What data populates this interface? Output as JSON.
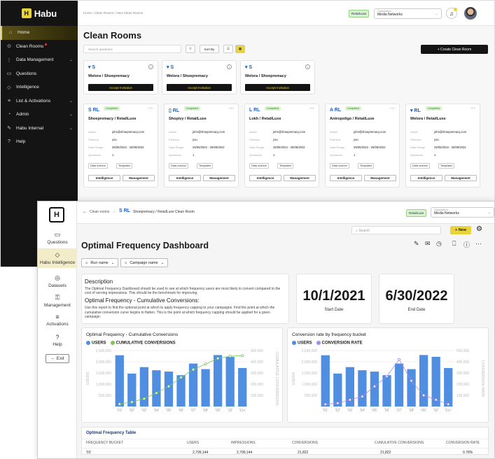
{
  "back": {
    "logo": "Habu",
    "nav": [
      {
        "label": "Home",
        "icon": "⌂",
        "active": true,
        "chev": false
      },
      {
        "label": "Clean Rooms",
        "icon": "⊙",
        "chev": false,
        "dot": true
      },
      {
        "label": "Data Management",
        "icon": "⋮",
        "chev": true
      },
      {
        "label": "Questions",
        "icon": "▭",
        "chev": false
      },
      {
        "label": "Intelligence",
        "icon": "◇",
        "chev": false
      },
      {
        "label": "List & Activations",
        "icon": "≡",
        "chev": true
      },
      {
        "label": "Admin",
        "icon": "◔",
        "chev": true
      },
      {
        "label": "Habu Internal",
        "icon": "✎",
        "chev": true
      },
      {
        "label": "Help",
        "icon": "?",
        "chev": false
      }
    ],
    "breadcrumb": "Home  /  Clean Rooms  /  View Clean Rooms",
    "chip": "RetailLuxe",
    "org_label": "Organization",
    "org_value": "Media Networks",
    "title": "Clean Rooms",
    "search_placeholder": "Search questions",
    "sort": "Sort By",
    "create": "+  Create Clean Room",
    "invites": [
      {
        "logo": "▾ S",
        "name": "Welora / Shoepremacy",
        "btn": "Accept Invitation"
      },
      {
        "logo": "▾ S",
        "name": "Welora / Shoepremacy",
        "btn": "Accept Invitation"
      },
      {
        "logo": "▾ S",
        "name": "Welora / Shoepremacy",
        "btn": "Accept Invitation"
      }
    ],
    "rooms": [
      {
        "logo": "S RL",
        "name": "Shoepremacy / RetailLuxe"
      },
      {
        "logo": "▯ RL",
        "name": "Shopivy / RetailLuxe"
      },
      {
        "logo": "L RL",
        "name": "Lokh / RetailLuxe"
      },
      {
        "logo": "A RL",
        "name": "Antropoligo / RetailLuxe"
      },
      {
        "logo": "▾ RL",
        "name": "Welora / RetailLuxe"
      }
    ],
    "room_tag": "Completed",
    "kv_keys": [
      "Admin",
      "Partners",
      "Data Range",
      "Questions"
    ],
    "kv_vals": [
      "john@shoepremacy.com",
      "you",
      "25/05/2022 - 25/06/2022",
      "1"
    ],
    "pills": [
      "Data science",
      "Templates"
    ],
    "btn_intel": "Intelligence",
    "btn_mgmt": "Management"
  },
  "front": {
    "logo": "H",
    "nav": [
      {
        "label": "Questions",
        "icon": "▭"
      },
      {
        "label": "Habu Intelligence",
        "icon": "◇",
        "active": true
      },
      {
        "label": "Datasets",
        "icon": "◎"
      },
      {
        "label": "Management",
        "icon": "⚿"
      },
      {
        "label": "Activations",
        "icon": "≡"
      },
      {
        "label": "Help",
        "icon": "?"
      },
      {
        "label": "← Exit",
        "icon": ""
      }
    ],
    "crumb_back": "Clean rooms",
    "crumb_logo": "S RL",
    "crumb": "Shoepremacy / RetailLuxe Clean Room",
    "chip": "RetailLuxe",
    "org_label": "Organization",
    "org_value": "Media Networks",
    "search_placeholder": "Search",
    "new_btn": "+  New",
    "title": "Optimal Frequency Dashboard",
    "filters": [
      "Run name",
      "Campaign name"
    ],
    "desc": {
      "h1": "Description",
      "p1": "The Optimal Frequency Dashboard should be used to see at which frequency users are most likely to convert compared to the cost of serving impressions. This should be the benchmark for improving.",
      "h2": "Optimal Frequency - Cumulative Conversions:",
      "p2": "Use this report to find the optional point at which to apply frequency capping to your campaigns. Find the point at which the cumulative conversion curve begins to flatten. This is the point at which frequency capping should be applied for a given campaign."
    },
    "start_date": "10/1/2021",
    "start_label": "Start Date",
    "end_date": "6/30/2022",
    "end_label": "End Date",
    "table": {
      "title": "Optimal Frequency Table",
      "headers": [
        "FREQUENCY BUCKET",
        "USERS",
        "IMPRESSIONS",
        "CONVERSIONS",
        "CUMULATIVE CONVERSIONS",
        "CONVERSION RATE"
      ],
      "row": [
        "'01'",
        "2,799,144",
        "2,799,144",
        "21,822",
        "21,822",
        "0.78%"
      ]
    }
  },
  "chart_data": [
    {
      "type": "bar",
      "title": "Optimal Frequency - Cumulative Conversions",
      "categories": [
        "'01'",
        "'02'",
        "'03'",
        "'04'",
        "'05'",
        "'06'",
        "'07'",
        "'08'",
        "'09'",
        "'10'",
        "'11+'"
      ],
      "ylabel": "USERS",
      "y2label": "CUMULATIVE CONVERSIONS",
      "ylim": [
        0,
        2500000
      ],
      "y2lim": [
        0,
        500000
      ],
      "yticks": [
        "2,500,000",
        "2,000,000",
        "1,500,000",
        "1,000,000",
        "500,000",
        ""
      ],
      "y2ticks": [
        "500,000",
        "400,000",
        "300,000",
        "200,000",
        "100,000",
        ""
      ],
      "series": [
        {
          "name": "USERS",
          "type": "bar",
          "color": "#4f8ee0",
          "values": [
            2290000,
            1470000,
            1760000,
            1620000,
            1560000,
            1400000,
            1920000,
            1670000,
            2300000,
            2220000,
            1720000
          ]
        },
        {
          "name": "CUMULATIVE CONVERSIONS",
          "type": "line",
          "color": "#7cc55b",
          "values": [
            21822,
            40000,
            70000,
            120000,
            180000,
            260000,
            330000,
            380000,
            430000,
            450000,
            455000
          ]
        }
      ]
    },
    {
      "type": "bar",
      "title": "Conversion rate by frequency bucket",
      "categories": [
        "'01'",
        "'02'",
        "'03'",
        "'04'",
        "'05'",
        "'06'",
        "'07'",
        "'08'",
        "'09'",
        "'10'",
        "'11+'"
      ],
      "ylabel": "USERS",
      "y2label": "CONVERSION RATE",
      "ylim": [
        0,
        2500000
      ],
      "y2lim": [
        0,
        500000
      ],
      "yticks": [
        "2,500,000",
        "2,000,000",
        "1,500,000",
        "1,000,000",
        "500,000",
        ""
      ],
      "y2ticks": [
        "500,000",
        "400,000",
        "300,000",
        "200,000",
        "100,000",
        ""
      ],
      "series": [
        {
          "name": "USERS",
          "type": "bar",
          "color": "#4f8ee0",
          "values": [
            2290000,
            1470000,
            1760000,
            1620000,
            1560000,
            1400000,
            1920000,
            1670000,
            2300000,
            2220000,
            1720000
          ]
        },
        {
          "name": "CONVERSION RATE",
          "type": "line",
          "color": "#a98be0",
          "values": [
            20000,
            30000,
            60000,
            90000,
            180000,
            270000,
            420000,
            230000,
            100000,
            60000,
            20000
          ]
        }
      ]
    }
  ]
}
